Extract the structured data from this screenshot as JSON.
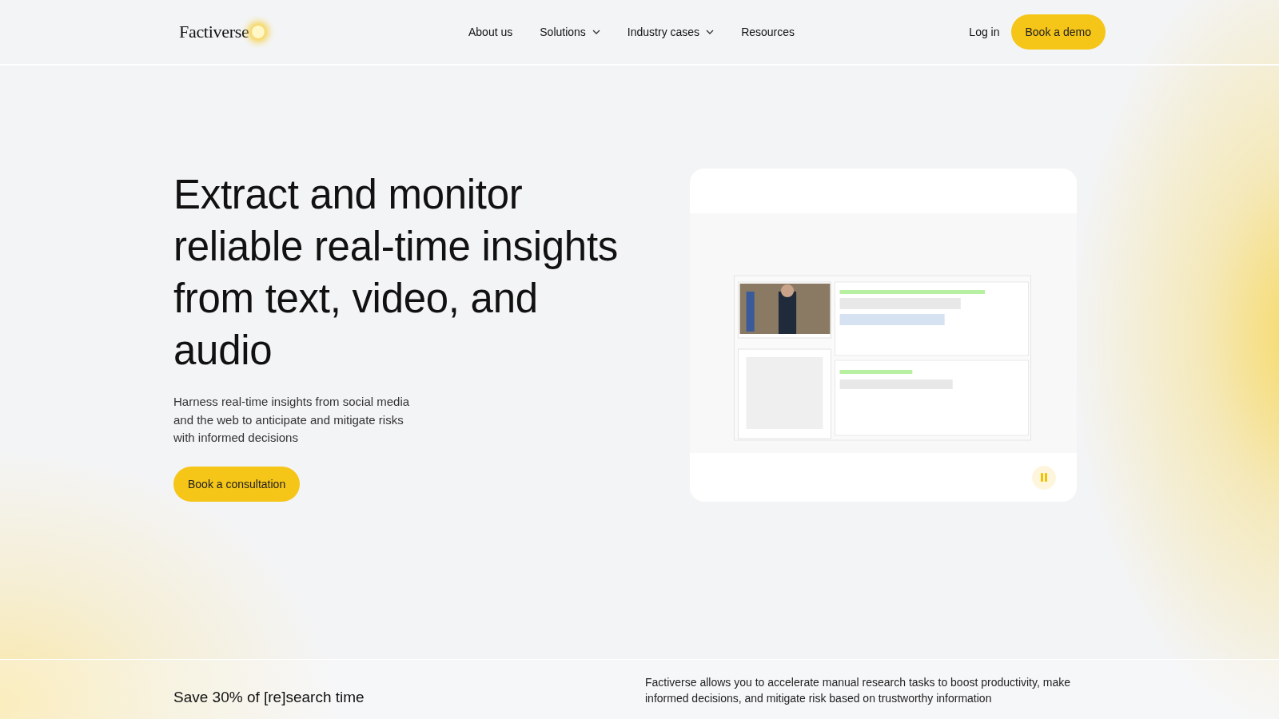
{
  "header": {
    "logo": "Factiverse",
    "nav": [
      {
        "label": "About us",
        "dropdown": false
      },
      {
        "label": "Solutions",
        "dropdown": true
      },
      {
        "label": "Industry cases",
        "dropdown": true
      },
      {
        "label": "Resources",
        "dropdown": false
      }
    ],
    "login": "Log in",
    "cta": "Book a demo"
  },
  "hero": {
    "title": "Extract and monitor reliable real-time insights from text, video, and audio",
    "subtitle": "Harness real-time insights from social media and the web to anticipate and mitigate risks with informed decisions",
    "cta": "Book a consultation"
  },
  "band": {
    "headline": "Save 30% of [re]search time",
    "text": "Factiverse allows you to accelerate manual research tasks to boost productivity, make informed decisions, and mitigate risk based on trustworthy information"
  }
}
